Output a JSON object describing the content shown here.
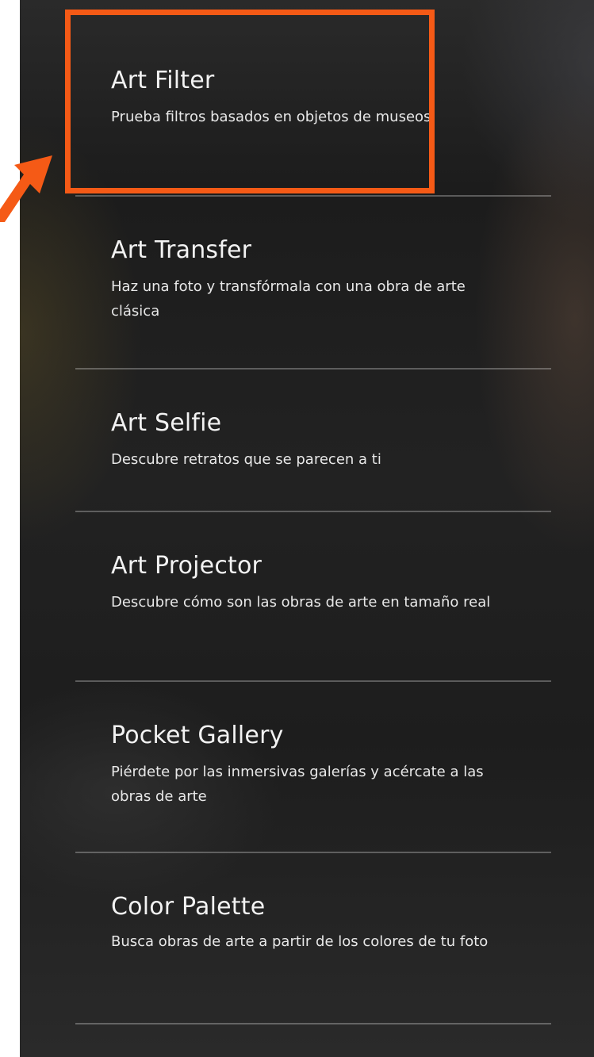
{
  "menu": {
    "items": [
      {
        "title": "Art Filter",
        "description": "Prueba filtros basados en objetos de museos"
      },
      {
        "title": "Art Transfer",
        "description": "Haz una foto y transfórmala con una obra de arte clásica"
      },
      {
        "title": "Art Selfie",
        "description": "Descubre retratos que se parecen a ti"
      },
      {
        "title": "Art Projector",
        "description": "Descubre cómo son las obras de arte en tamaño real"
      },
      {
        "title": "Pocket Gallery",
        "description": "Piérdete por las inmersivas galerías y acércate a las obras de arte"
      },
      {
        "title": "Color Palette",
        "description": "Busca obras de arte a partir de los colores de tu foto"
      }
    ]
  },
  "annotation": {
    "highlight_color": "#f55a16",
    "highlighted_item": "Art Filter",
    "pointer": "arrow-icon"
  }
}
